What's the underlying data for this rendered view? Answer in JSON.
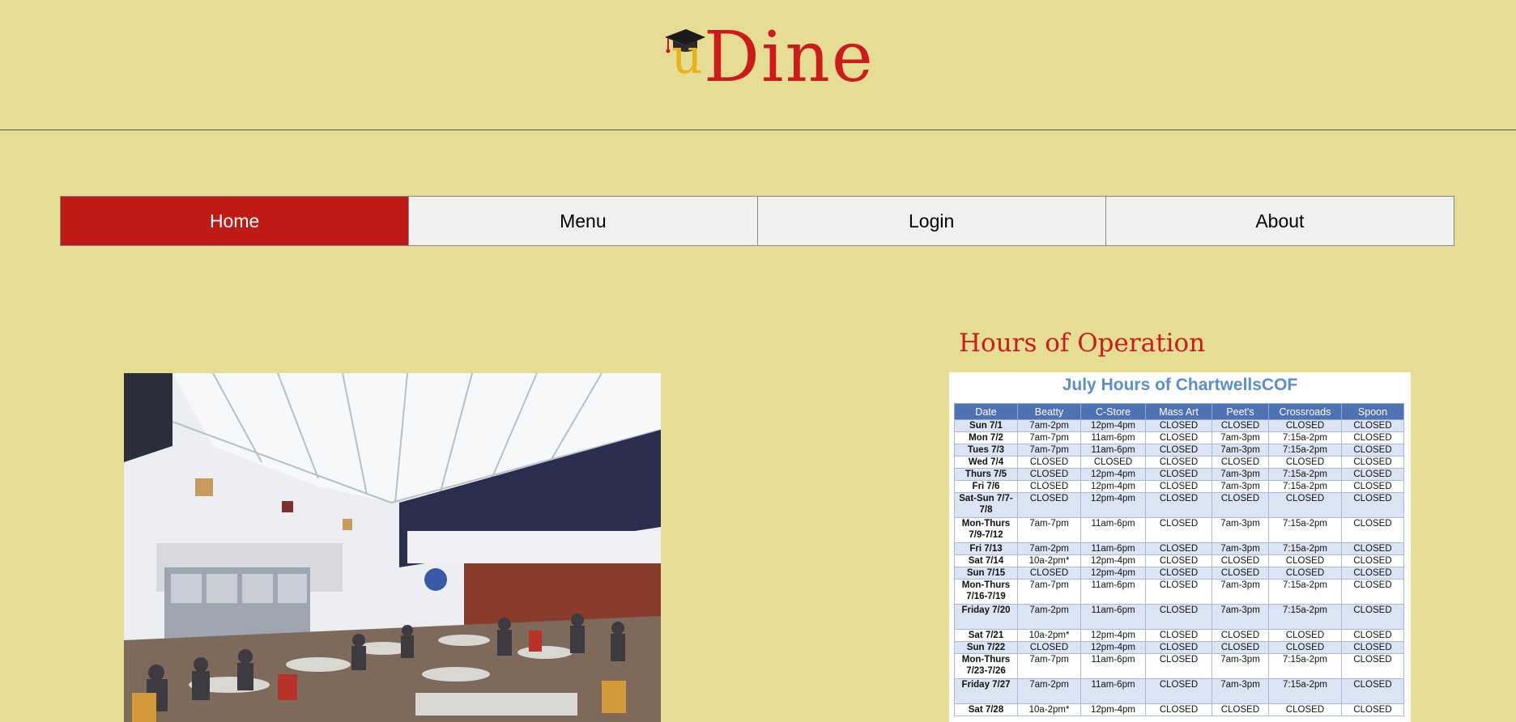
{
  "brand": {
    "logo_u": "u",
    "logo_dine": "Dine"
  },
  "nav": [
    {
      "label": "Home",
      "active": true
    },
    {
      "label": "Menu",
      "active": false
    },
    {
      "label": "Login",
      "active": false
    },
    {
      "label": "About",
      "active": false
    }
  ],
  "hours": {
    "title": "Hours of Operation",
    "schedule_title": "July Hours of ChartwellsCOF",
    "columns": [
      "Date",
      "Beatty",
      "C-Store",
      "Mass Art",
      "Peet's",
      "Crossroads",
      "Spoon"
    ],
    "rows": [
      [
        "Sun 7/1",
        "7am-2pm",
        "12pm-4pm",
        "CLOSED",
        "CLOSED",
        "CLOSED",
        "CLOSED"
      ],
      [
        "Mon 7/2",
        "7am-7pm",
        "11am-6pm",
        "CLOSED",
        "7am-3pm",
        "7:15a-2pm",
        "CLOSED"
      ],
      [
        "Tues 7/3",
        "7am-7pm",
        "11am-6pm",
        "CLOSED",
        "7am-3pm",
        "7:15a-2pm",
        "CLOSED"
      ],
      [
        "Wed 7/4",
        "CLOSED",
        "CLOSED",
        "CLOSED",
        "CLOSED",
        "CLOSED",
        "CLOSED"
      ],
      [
        "Thurs 7/5",
        "CLOSED",
        "12pm-4pm",
        "CLOSED",
        "7am-3pm",
        "7:15a-2pm",
        "CLOSED"
      ],
      [
        "Fri 7/6",
        "CLOSED",
        "12pm-4pm",
        "CLOSED",
        "7am-3pm",
        "7:15a-2pm",
        "CLOSED"
      ],
      [
        "Sat-Sun 7/7-7/8",
        "CLOSED",
        "12pm-4pm",
        "CLOSED",
        "CLOSED",
        "CLOSED",
        "CLOSED"
      ],
      [
        "Mon-Thurs 7/9-7/12",
        "7am-7pm",
        "11am-6pm",
        "CLOSED",
        "7am-3pm",
        "7:15a-2pm",
        "CLOSED"
      ],
      [
        "Fri 7/13",
        "7am-2pm",
        "11am-6pm",
        "CLOSED",
        "7am-3pm",
        "7:15a-2pm",
        "CLOSED"
      ],
      [
        "Sat 7/14",
        "10a-2pm*",
        "12pm-4pm",
        "CLOSED",
        "CLOSED",
        "CLOSED",
        "CLOSED"
      ],
      [
        "Sun 7/15",
        "CLOSED",
        "12pm-4pm",
        "CLOSED",
        "CLOSED",
        "CLOSED",
        "CLOSED"
      ],
      [
        "Mon-Thurs 7/16-7/19",
        "7am-7pm",
        "11am-6pm",
        "CLOSED",
        "7am-3pm",
        "7:15a-2pm",
        "CLOSED"
      ],
      [
        "Friday 7/20",
        "7am-2pm",
        "11am-6pm",
        "CLOSED",
        "7am-3pm",
        "7:15a-2pm",
        "CLOSED"
      ],
      [
        "Sat 7/21",
        "10a-2pm*",
        "12pm-4pm",
        "CLOSED",
        "CLOSED",
        "CLOSED",
        "CLOSED"
      ],
      [
        "Sun 7/22",
        "CLOSED",
        "12pm-4pm",
        "CLOSED",
        "CLOSED",
        "CLOSED",
        "CLOSED"
      ],
      [
        "Mon-Thurs 7/23-7/26",
        "7am-7pm",
        "11am-6pm",
        "CLOSED",
        "7am-3pm",
        "7:15a-2pm",
        "CLOSED"
      ],
      [
        "Friday 7/27",
        "7am-2pm",
        "11am-6pm",
        "CLOSED",
        "7am-3pm",
        "7:15a-2pm",
        "CLOSED"
      ],
      [
        "Sat 7/28",
        "10a-2pm*",
        "12pm-4pm",
        "CLOSED",
        "CLOSED",
        "CLOSED",
        "CLOSED"
      ]
    ]
  }
}
